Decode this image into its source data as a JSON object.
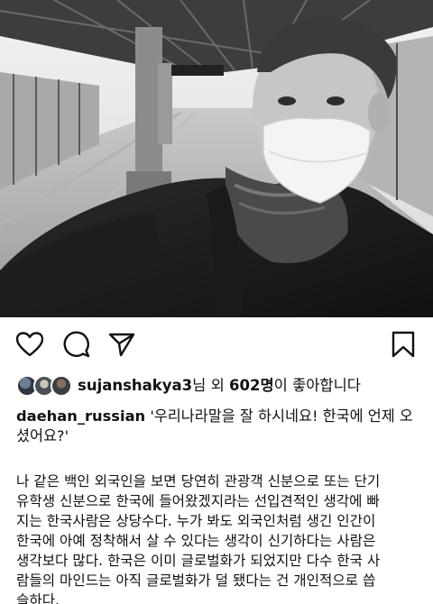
{
  "post": {
    "image_icon": "selfie-photo",
    "likes": {
      "user": "sujanshakya3",
      "suffix_1": "님 외 ",
      "count": "602명",
      "suffix_2": "이 좋아합니다"
    },
    "caption": {
      "username": "daehan_russian",
      "quote": "'우리나라말을 잘 하시네요! 한국에 언제 오셨어요?'",
      "lines": [
        "나 같은 백인 외국인을 보면 당연히 관광객 신분으로 또는 단기",
        "유학생 신분으로 한국에 들어왔겠지라는 선입견적인 생각에 빠",
        "지는 한국사람은 상당수다. 누가 봐도 외국인처럼 생긴 인간이",
        "한국에 아예 정착해서 살 수 있다는 생각이 신기하다는 사람은",
        "생각보다 많다. 한국은 이미 글로벌화가 되었지만 다수 한국 사",
        "람들의 마인드는 아직 글로벌화가 덜 됐다는 건 개인적으로 씁",
        "슬하다."
      ]
    }
  },
  "icons": {
    "like": "heart-icon",
    "comment": "comment-icon",
    "share": "send-icon",
    "save": "bookmark-icon"
  }
}
